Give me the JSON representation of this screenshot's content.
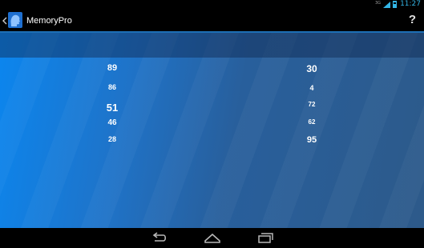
{
  "status_bar": {
    "network_label": "3G",
    "time": "11:27"
  },
  "action_bar": {
    "title": "MemoryPro",
    "help_label": "?"
  },
  "numbers": {
    "left": [
      "89",
      "86",
      "51",
      "46",
      "28"
    ],
    "right": [
      "30",
      "4",
      "72",
      "62",
      "95"
    ]
  },
  "icons": {
    "up": "chevron-left-icon",
    "app": "head-silhouette-icon",
    "back": "back-icon",
    "home": "home-icon",
    "recents": "recent-apps-icon"
  },
  "colors": {
    "accent": "#33b5e5",
    "gradient_start": "#0b86ef",
    "gradient_end": "#2d5a8a"
  }
}
